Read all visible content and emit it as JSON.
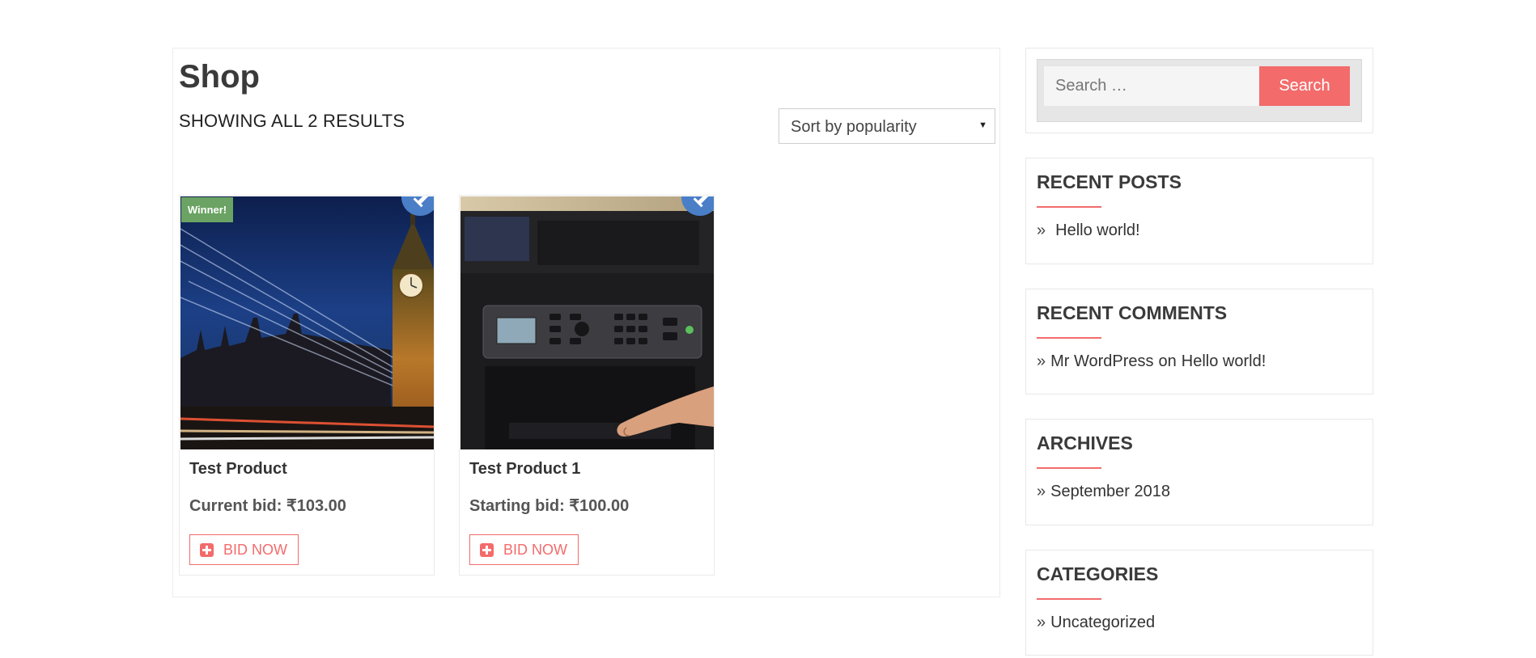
{
  "shop": {
    "title": "Shop",
    "result_count": "SHOWING ALL 2 RESULTS",
    "sort": {
      "selected": "Sort by popularity"
    }
  },
  "products": [
    {
      "name": "Test Product",
      "bid": "Current bid: ₹103.00",
      "button_label": "BID NOW",
      "badge": "Winner!",
      "image": "big-ben-night-photo"
    },
    {
      "name": "Test Product 1",
      "bid": "Starting bid: ₹100.00",
      "button_label": "BID NOW",
      "image": "printer-photo"
    }
  ],
  "sidebar": {
    "search": {
      "placeholder": "Search …",
      "button_label": "Search"
    },
    "recent_posts": {
      "title": "RECENT POSTS",
      "items": [
        "Hello world!"
      ]
    },
    "recent_comments": {
      "title": "RECENT COMMENTS",
      "items": [
        {
          "author": "Mr WordPress",
          "connector": "on",
          "post": "Hello world!"
        }
      ]
    },
    "archives": {
      "title": "ARCHIVES",
      "items": [
        "September 2018"
      ]
    },
    "categories": {
      "title": "CATEGORIES",
      "items": [
        "Uncategorized"
      ]
    }
  },
  "colors": {
    "accent": "#f36b6b",
    "winner_badge": "#6aa363",
    "auction_icon": "#4a7fc8"
  }
}
